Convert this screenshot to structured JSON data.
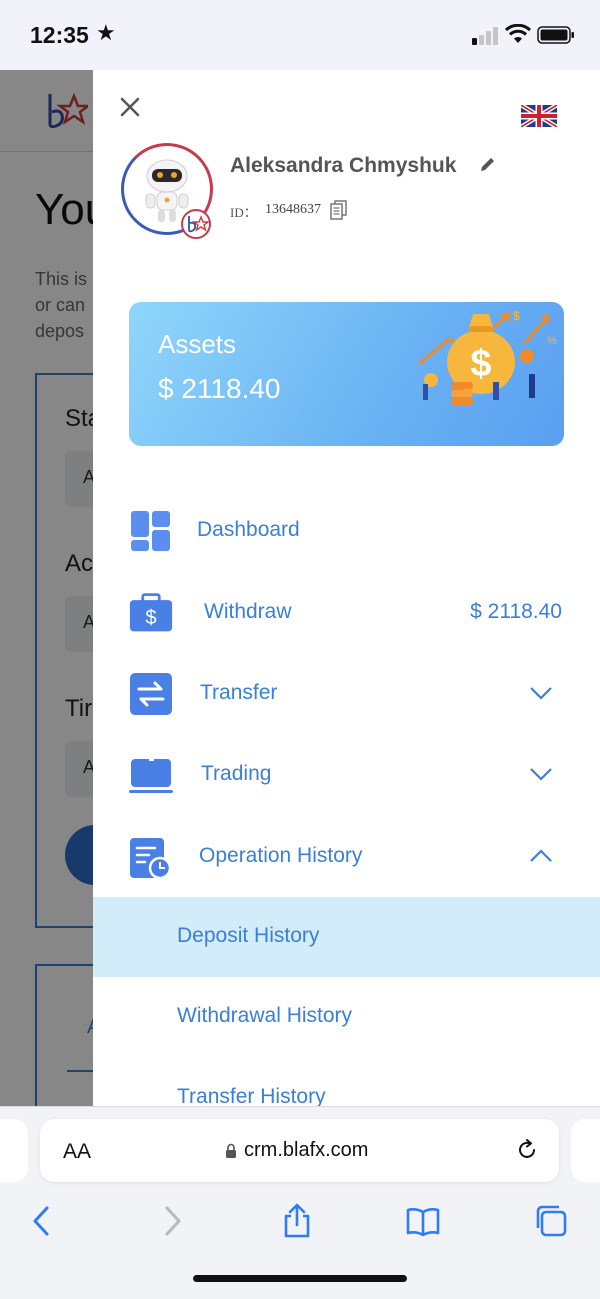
{
  "status_bar": {
    "time": "12:35",
    "star": "★",
    "icons": [
      "cellular-signal-icon",
      "wifi-icon",
      "battery-icon"
    ]
  },
  "background_page": {
    "title_fragment": "You",
    "desc_lines": [
      "This is",
      "or can",
      "depos"
    ],
    "labels": [
      "Sta",
      "Ac",
      "Tir"
    ],
    "field_fragments": [
      "A",
      "A",
      "A"
    ],
    "tab_fragment": "A"
  },
  "drawer": {
    "close_icon": "close-icon",
    "language_flag": "uk-flag-icon",
    "user": {
      "name": "Aleksandra Chmyshuk",
      "id_label": "ID：",
      "id": "13648637"
    },
    "assets": {
      "label": "Assets",
      "value": "$ 2118.40"
    },
    "menu": [
      {
        "label": "Dashboard",
        "icon": "dashboard-icon"
      },
      {
        "label": "Withdraw",
        "icon": "wallet-icon",
        "amount": "$ 2118.40"
      },
      {
        "label": "Transfer",
        "icon": "transfer-icon",
        "chevron": "down"
      },
      {
        "label": "Trading",
        "icon": "laptop-icon",
        "chevron": "down"
      },
      {
        "label": "Operation History",
        "icon": "history-icon",
        "chevron": "up"
      }
    ],
    "submenu": [
      {
        "label": "Deposit History",
        "active": true
      },
      {
        "label": "Withdrawal History",
        "active": false
      },
      {
        "label": "Transfer History",
        "active": false
      }
    ]
  },
  "browser": {
    "text_size_label": "AA",
    "url": "crm.blafx.com",
    "toolbar": [
      "back-icon",
      "forward-icon",
      "share-icon",
      "bookmarks-icon",
      "tabs-icon"
    ]
  },
  "colors": {
    "accent": "#3a7fd8",
    "active_row": "#d3ecfa",
    "assets_gradient_start": "#8fd6fb",
    "assets_gradient_end": "#5a9ff0"
  }
}
